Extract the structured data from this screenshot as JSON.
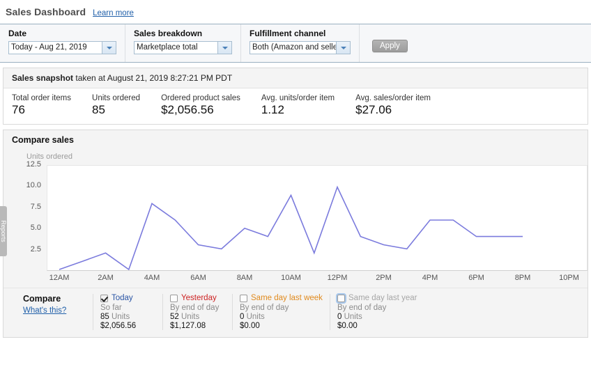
{
  "header": {
    "title": "Sales Dashboard",
    "learn_more": "Learn more"
  },
  "filters": {
    "date": {
      "label": "Date",
      "value": "Today - Aug 21, 2019",
      "caret_icon": "chevron-down-icon"
    },
    "breakdown": {
      "label": "Sales breakdown",
      "value": "Marketplace total",
      "caret_icon": "chevron-down-icon"
    },
    "fulfillment": {
      "label": "Fulfillment channel",
      "value": "Both (Amazon and selle",
      "caret_icon": "chevron-down-icon"
    },
    "apply_label": "Apply"
  },
  "snapshot": {
    "title": "Sales snapshot",
    "subtitle": " taken at August 21, 2019 8:27:21 PM PDT",
    "metrics": [
      {
        "label": "Total order items",
        "value": "76"
      },
      {
        "label": "Units ordered",
        "value": "85"
      },
      {
        "label": "Ordered product sales",
        "value": "$2,056.56"
      },
      {
        "label": "Avg. units/order item",
        "value": "1.12"
      },
      {
        "label": "Avg. sales/order item",
        "value": "$27.06"
      }
    ]
  },
  "chart_panel": {
    "title": "Compare sales"
  },
  "chart_data": {
    "type": "line",
    "title": "Compare sales",
    "ylabel": "Units ordered",
    "xlabel": "",
    "ylim": [
      0,
      12.5
    ],
    "yticks": [
      2.5,
      5.0,
      7.5,
      10.0,
      12.5
    ],
    "ytick_labels": [
      "2.5",
      "5.0",
      "7.5",
      "10.0",
      "12.5"
    ],
    "xticks": [
      "12AM",
      "2AM",
      "4AM",
      "6AM",
      "8AM",
      "10AM",
      "12PM",
      "2PM",
      "4PM",
      "6PM",
      "8PM",
      "10PM"
    ],
    "grid": false,
    "legend_position": "bottom",
    "line_color": "#7b7bdd",
    "x": [
      0,
      1,
      2,
      3,
      4,
      5,
      6,
      7,
      8,
      9,
      10,
      11,
      12,
      13,
      14,
      15,
      16,
      17,
      18,
      19,
      20
    ],
    "series": [
      {
        "name": "Today",
        "color": "#7b7bdd",
        "values": [
          0,
          1,
          2,
          0,
          8,
          6,
          3,
          2.5,
          5,
          4,
          9,
          2,
          10,
          4,
          3,
          2.5,
          6,
          6,
          4,
          4,
          4
        ]
      }
    ]
  },
  "compare": {
    "title": "Compare",
    "whats_this": "What's this?",
    "series": [
      {
        "name": "Today",
        "color": "#2a55a5",
        "checked": true,
        "focused": false,
        "subtitle": "So far",
        "units": "85",
        "units_label": "Units",
        "money": "$2,056.56"
      },
      {
        "name": "Yesterday",
        "color": "#cc2222",
        "checked": false,
        "focused": false,
        "subtitle": "By end of day",
        "units": "52",
        "units_label": "Units",
        "money": "$1,127.08"
      },
      {
        "name": "Same day last week",
        "color": "#e08a1e",
        "checked": false,
        "focused": false,
        "subtitle": "By end of day",
        "units": "0",
        "units_label": "Units",
        "money": "$0.00"
      },
      {
        "name": "Same day last year",
        "color": "#a6a6a6",
        "checked": false,
        "focused": true,
        "subtitle": "By end of day",
        "units": "0",
        "units_label": "Units",
        "money": "$0.00"
      }
    ]
  },
  "side_tab": {
    "label": "Reports"
  }
}
